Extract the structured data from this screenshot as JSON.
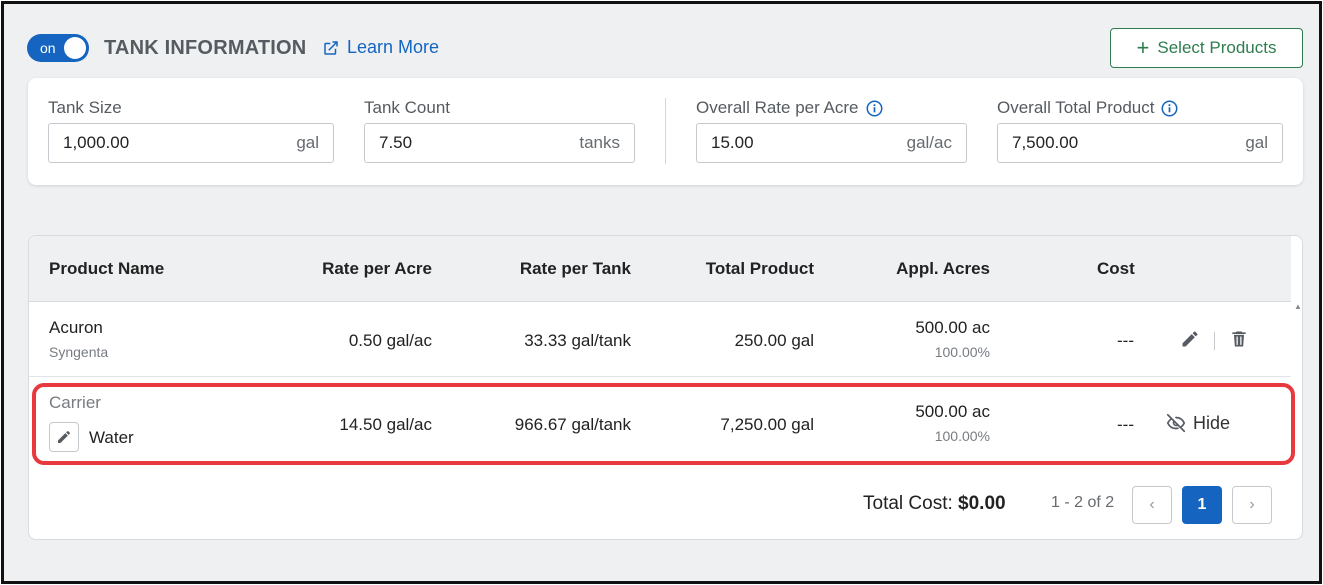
{
  "header": {
    "toggle_label": "on",
    "section_title": "TANK INFORMATION",
    "learn_more": "Learn More",
    "select_products": "Select Products"
  },
  "inputs": {
    "tank_size": {
      "label": "Tank Size",
      "value": "1,000.00",
      "unit": "gal"
    },
    "tank_count": {
      "label": "Tank Count",
      "value": "7.50",
      "unit": "tanks"
    },
    "overall_rate": {
      "label": "Overall Rate per Acre",
      "value": "15.00",
      "unit": "gal/ac"
    },
    "overall_total": {
      "label": "Overall Total Product",
      "value": "7,500.00",
      "unit": "gal"
    }
  },
  "table": {
    "columns": {
      "product_name": "Product Name",
      "rate_per_acre": "Rate per Acre",
      "rate_per_tank": "Rate per Tank",
      "total_product": "Total Product",
      "appl_acres": "Appl. Acres",
      "cost": "Cost"
    },
    "rows": [
      {
        "name": "Acuron",
        "manufacturer": "Syngenta",
        "rate_per_acre": "0.50 gal/ac",
        "rate_per_tank": "33.33 gal/tank",
        "total_product": "250.00 gal",
        "appl_acres": "500.00 ac",
        "appl_pct": "100.00%",
        "cost": "---"
      },
      {
        "type_label": "Carrier",
        "name": "Water",
        "rate_per_acre": "14.50 gal/ac",
        "rate_per_tank": "966.67 gal/tank",
        "total_product": "7,250.00 gal",
        "appl_acres": "500.00 ac",
        "appl_pct": "100.00%",
        "cost": "---",
        "hide_label": "Hide"
      }
    ]
  },
  "footer": {
    "total_cost_label": "Total Cost:",
    "total_cost_value": "$0.00",
    "range": "1 - 2 of 2",
    "current_page": "1"
  },
  "colors": {
    "primary": "#1565c0",
    "green": "#2e7d4f",
    "highlight": "#e8393f"
  }
}
